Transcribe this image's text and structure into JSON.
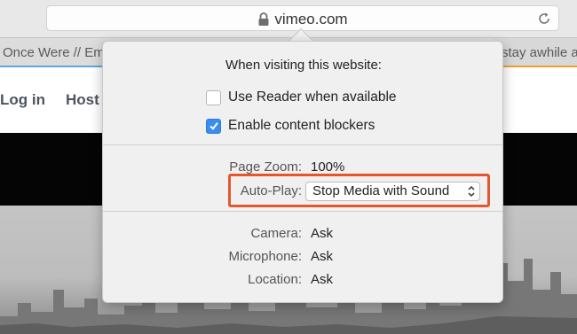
{
  "toolbar": {
    "address": "vimeo.com",
    "lock_icon": "lock-icon",
    "reload_icon": "reload-icon"
  },
  "tabs": {
    "left_label": "Once Were // Em",
    "right_label": "stay awhile a"
  },
  "page": {
    "nav": [
      "Log in",
      "Host"
    ]
  },
  "popover": {
    "title": "When visiting this website:",
    "checkboxes": [
      {
        "label": "Use Reader when available",
        "checked": false
      },
      {
        "label": "Enable content blockers",
        "checked": true
      }
    ],
    "zoom_label": "Page Zoom:",
    "zoom_value": "100%",
    "autoplay_label": "Auto-Play:",
    "autoplay_value": "Stop Media with Sound",
    "camera_label": "Camera:",
    "camera_value": "Ask",
    "microphone_label": "Microphone:",
    "microphone_value": "Ask",
    "location_label": "Location:",
    "location_value": "Ask"
  },
  "colors": {
    "highlight": "#e4572e",
    "checkbox_on": "#3a8cf0"
  }
}
